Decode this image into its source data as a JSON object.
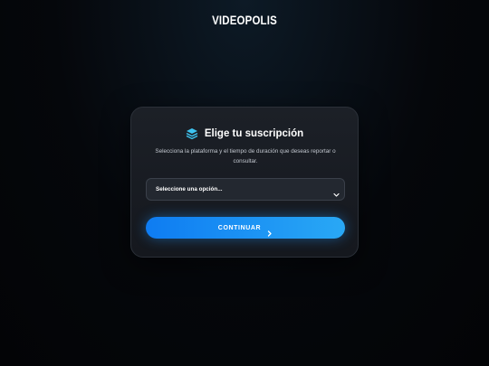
{
  "header": {
    "logo_text": "VIDEOPOLIS"
  },
  "card": {
    "title": "Elige tu suscripción",
    "title_icon": "layers-icon",
    "subtitle": "Selecciona la plataforma y el tiempo de duración que deseas reportar o consultar.",
    "select": {
      "selected_value": "Seleccione una opción...",
      "icon": "chevron-down-icon"
    },
    "button": {
      "label": "CONTINUAR",
      "icon": "chevron-right-icon"
    }
  },
  "colors": {
    "accent": "#1a8ff3",
    "accent_light": "#29a8f5",
    "icon_cyan": "#3ec3f0",
    "background": "#05070b",
    "card": "#1a1d23"
  }
}
